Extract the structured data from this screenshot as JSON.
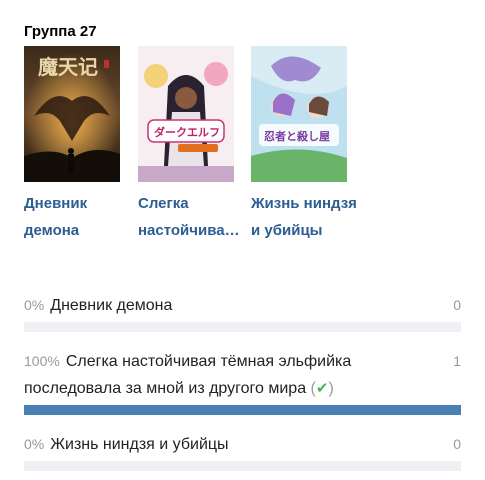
{
  "group": {
    "title": "Группа 27"
  },
  "cards": [
    {
      "title": "Дневник демона",
      "poster": "dark-dragon-poster"
    },
    {
      "title": "Слегка настойчивая тёмная эльфийка",
      "poster": "dark-elf-poster"
    },
    {
      "title": "Жизнь ниндзя и убийцы",
      "poster": "ninja-girls-poster"
    }
  ],
  "poll": {
    "options": [
      {
        "percent": "0%",
        "label": "Дневник демона",
        "count": "0",
        "fraction": 0
      },
      {
        "percent": "100%",
        "label": "Слегка настойчивая тёмная эльфийка последовала за мной из другого мира",
        "count": "1",
        "fraction": 1,
        "voted": true
      },
      {
        "percent": "0%",
        "label": "Жизнь ниндзя и убийцы",
        "count": "0",
        "fraction": 0
      }
    ],
    "vote_mark": {
      "open": "(",
      "icon": "✔",
      "close": ")"
    }
  },
  "colors": {
    "link": "#2c5d93",
    "bar_fill": "#4a7fb5",
    "bar_track": "#eef0f3",
    "check": "#4bb34b"
  }
}
